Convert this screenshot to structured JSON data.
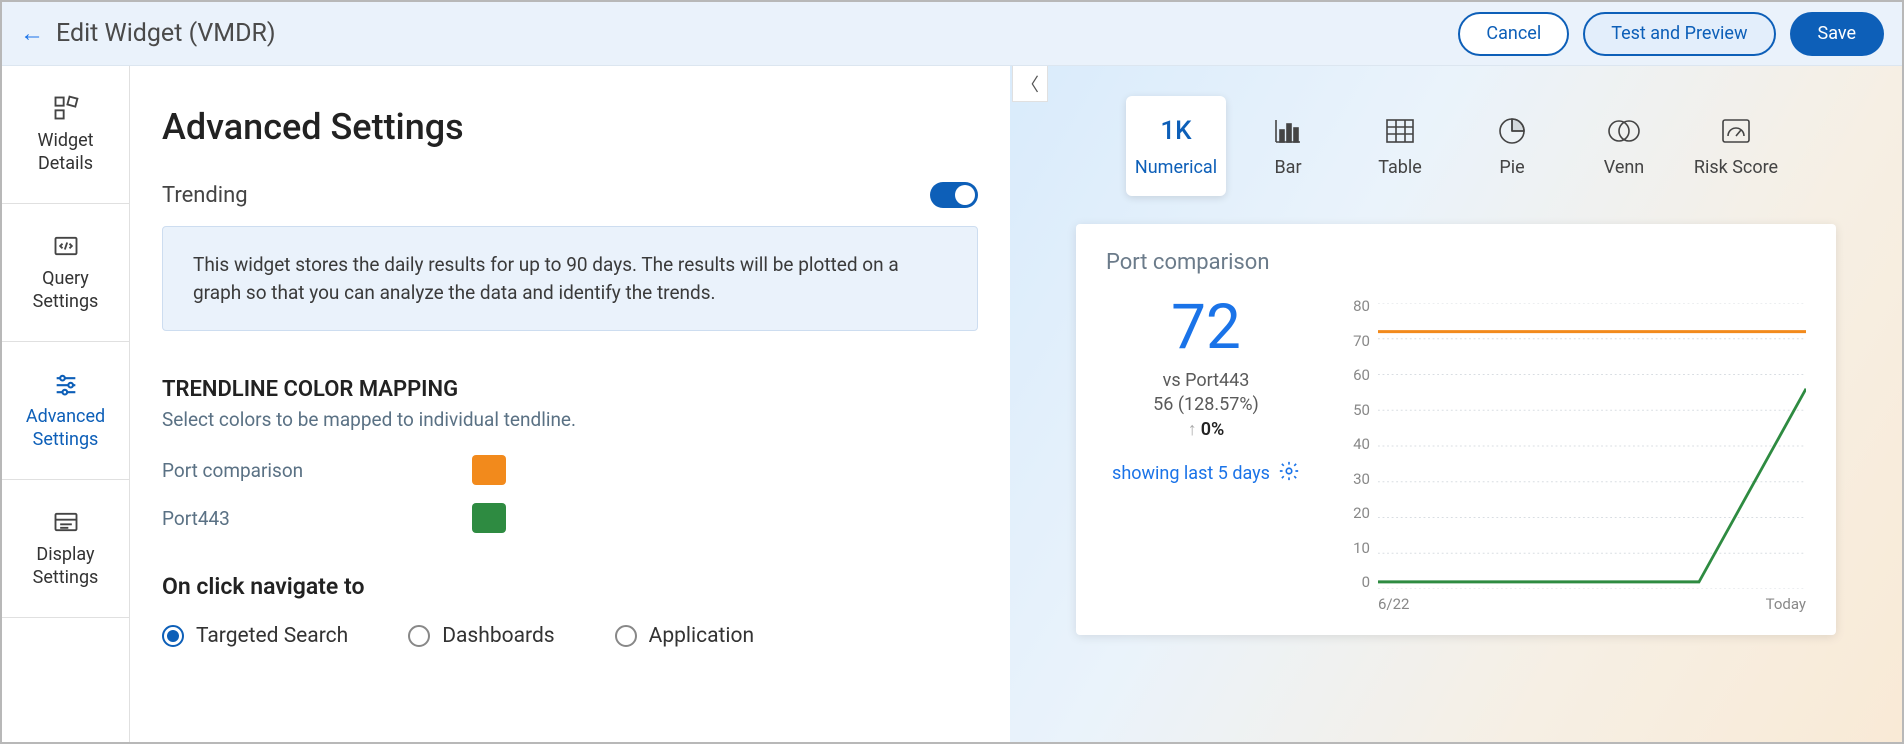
{
  "header": {
    "title": "Edit Widget (VMDR)",
    "cancel": "Cancel",
    "preview": "Test and Preview",
    "save": "Save"
  },
  "sidebar": {
    "items": [
      {
        "label": "Widget Details"
      },
      {
        "label": "Query Settings"
      },
      {
        "label": "Advanced Settings"
      },
      {
        "label": "Display Settings"
      }
    ]
  },
  "settings": {
    "heading": "Advanced Settings",
    "trending_label": "Trending",
    "info_text": "This widget stores the daily results for up to 90 days. The results will be plotted on a graph so that you can analyze the data and identify the trends.",
    "trendline_title": "TRENDLINE COLOR MAPPING",
    "trendline_sub": "Select colors to be mapped to individual tendline.",
    "series": [
      {
        "label": "Port comparison",
        "color": "#f28a1c"
      },
      {
        "label": "Port443",
        "color": "#2e8b41"
      }
    ],
    "nav_title": "On click navigate to",
    "nav_options": [
      {
        "label": "Targeted Search",
        "selected": true
      },
      {
        "label": "Dashboards",
        "selected": false
      },
      {
        "label": "Application",
        "selected": false
      }
    ]
  },
  "chart_types": [
    {
      "label": "Numerical",
      "icon": "1K",
      "active": true
    },
    {
      "label": "Bar",
      "icon": "bar"
    },
    {
      "label": "Table",
      "icon": "table"
    },
    {
      "label": "Pie",
      "icon": "pie"
    },
    {
      "label": "Venn",
      "icon": "venn"
    },
    {
      "label": "Risk Score",
      "icon": "gauge"
    }
  ],
  "preview": {
    "card_title": "Port comparison",
    "big_number": "72",
    "vs_label": "vs Port443",
    "secondary": "56 (128.57%)",
    "delta": "0%",
    "showing": "showing last 5 days",
    "x_start": "6/22",
    "x_end": "Today"
  },
  "chart_data": {
    "type": "line",
    "y_ticks": [
      80,
      70,
      60,
      50,
      40,
      30,
      20,
      10,
      0
    ],
    "x_labels": [
      "6/22",
      "Today"
    ],
    "ylim": [
      0,
      80
    ],
    "series": [
      {
        "name": "Port comparison",
        "color": "#f28a1c",
        "values": [
          72,
          72,
          72,
          72,
          72
        ]
      },
      {
        "name": "Port443",
        "color": "#2e8b41",
        "values": [
          2,
          2,
          2,
          2,
          56
        ]
      }
    ]
  }
}
